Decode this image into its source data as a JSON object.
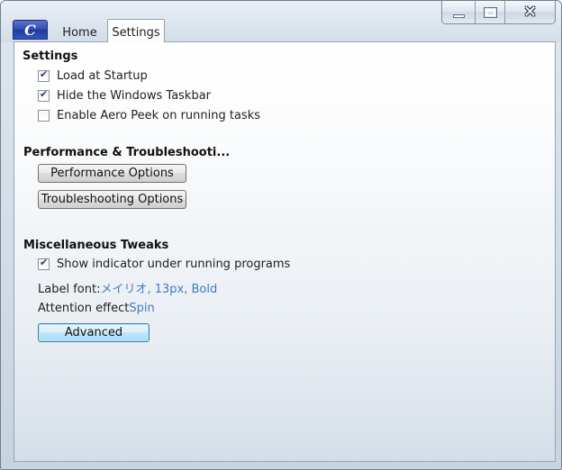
{
  "window": {
    "caption_buttons": {
      "minimize_icon": "minimize-icon",
      "maximize_icon": "maximize-icon",
      "close_icon": "close-x"
    }
  },
  "app_button": {
    "icon": "app-logo-icon",
    "glyph": "C"
  },
  "tabs": [
    {
      "label": "Home",
      "active": false
    },
    {
      "label": "Settings",
      "active": true
    }
  ],
  "settings": {
    "title": "Settings",
    "options": [
      {
        "label": "Load at Startup",
        "checked": true
      },
      {
        "label": "Hide the Windows Taskbar",
        "checked": true
      },
      {
        "label": "Enable Aero Peek on running tasks",
        "checked": false
      }
    ]
  },
  "performance": {
    "title": "Performance & Troubleshooti...",
    "buttons": {
      "performance": "Performance Options",
      "troubleshooting": "Troubleshooting Options"
    }
  },
  "misc": {
    "title": "Miscellaneous Tweaks",
    "show_indicator": {
      "label": "Show indicator under running programs",
      "checked": true
    },
    "label_font": {
      "label": "Label font:",
      "value": "メイリオ, 13px, Bold"
    },
    "attention_effect": {
      "label": "Attention effect",
      "value": "Spin"
    },
    "advanced_button": "Advanced"
  },
  "colors": {
    "link": "#3f7bc4",
    "app_button": "#2f4bb0",
    "check": "#2b3f8f"
  }
}
